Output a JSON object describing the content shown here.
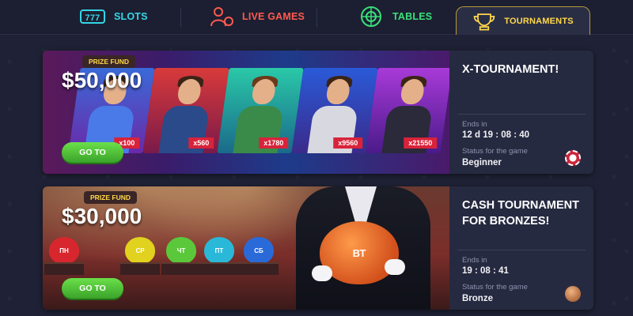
{
  "nav": {
    "items": [
      {
        "label": "SLOTS",
        "icon": "slots-777-icon",
        "color": "#35d6e6"
      },
      {
        "label": "LIVE GAMES",
        "icon": "dealer-chips-icon",
        "color": "#ff5a4f"
      },
      {
        "label": "TABLES",
        "icon": "roulette-wheel-icon",
        "color": "#39e07a"
      },
      {
        "label": "TOURNAMENTS",
        "icon": "trophy-cup-icon",
        "color": "#ffd84a",
        "active": true
      }
    ]
  },
  "tournaments": [
    {
      "prize_label": "PRIZE FUND",
      "prize_amount": "$50,000",
      "button_label": "GO TO",
      "title": "X-TOURNAMENT!",
      "ends_label": "Ends in",
      "ends_value": "12 d 19 : 08 : 40",
      "status_label": "Status for the game",
      "status_value": "Beginner",
      "badge_icon": "poker-chip-red-icon",
      "multipliers": [
        "x100",
        "x560",
        "x1780",
        "x9560",
        "x21550"
      ]
    },
    {
      "prize_label": "PRIZE FUND",
      "prize_amount": "$30,000",
      "button_label": "GO TO",
      "title": "CASH TOURNAMENT FOR BRONZES!",
      "ends_label": "Ends in",
      "ends_value": "19 : 08 : 41",
      "status_label": "Status for the game",
      "status_value": "Bronze",
      "badge_icon": "bronze-coin-icon",
      "pigs": [
        "ПН",
        "СР",
        "ЧТ",
        "ПТ",
        "СБ"
      ],
      "big_pig_label": "ВТ"
    }
  ]
}
